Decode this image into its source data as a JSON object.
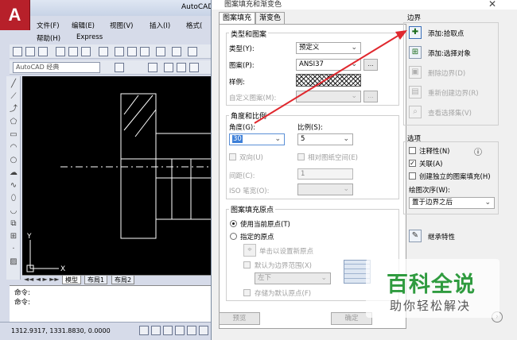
{
  "autocad": {
    "title": "AutoCAD",
    "logo": "A",
    "menu": [
      "文件(F)",
      "编辑(E)",
      "视图(V)",
      "插入(I)",
      "格式(",
      "帮助(H)",
      "Express"
    ],
    "workspace": "AutoCAD 经典",
    "layout_tabs": [
      "模型",
      "布局1",
      "布局2"
    ],
    "command_lines": [
      "命令:",
      "命令:"
    ],
    "coordinates": "1312.9317, 1331.8830, 0.0000",
    "axis_y": "Y",
    "axis_x": "X"
  },
  "dialog": {
    "title": "图案填充和渐变色",
    "tabs": [
      "图案填充",
      "渐变色"
    ],
    "type_pattern": {
      "group_title": "类型和图案",
      "type_label": "类型(Y):",
      "type_value": "预定义",
      "pattern_label": "图案(P):",
      "pattern_value": "ANSI37",
      "pattern_browse": "...",
      "swatch_label": "样例:",
      "custom_label": "自定义图案(M):",
      "custom_browse": "..."
    },
    "angle_scale": {
      "group_title": "角度和比例",
      "angle_label": "角度(G):",
      "angle_value": "30",
      "scale_label": "比例(S):",
      "scale_value": "5",
      "double_label": "双向(U)",
      "relative_label": "相对图纸空间(E)",
      "spacing_label": "间距(C):",
      "spacing_value": "1",
      "iso_label": "ISO 笔宽(O):"
    },
    "origin": {
      "group_title": "图案填充原点",
      "use_current": "使用当前原点(T)",
      "specified": "指定的原点",
      "click_set": "单击以设置新原点",
      "default_boundary": "默认为边界范围(X)",
      "position_value": "左下",
      "store_default": "存储为默认原点(F)"
    },
    "boundary": {
      "group_title": "边界",
      "add_pick": "添加:拾取点",
      "add_select": "添加:选择对象",
      "remove": "删除边界(D)",
      "recreate": "重新创建边界(R)",
      "view_selection": "查看选择集(V)"
    },
    "options": {
      "group_title": "选项",
      "annotative": "注释性(N)",
      "associative": "关联(A)",
      "independent": "创建独立的图案填充(H)",
      "draw_order_label": "绘图次序(W):",
      "draw_order_value": "置于边界之后"
    },
    "inherit": "继承特性",
    "buttons": {
      "preview": "预览",
      "ok": "确定"
    }
  },
  "watermark": {
    "main": "百科全说",
    "sub": "助你轻松解决"
  },
  "colors": {
    "arrow": "#e0282e",
    "watermark_green": "#2f9b3f",
    "autocad_red": "#b7202a"
  }
}
